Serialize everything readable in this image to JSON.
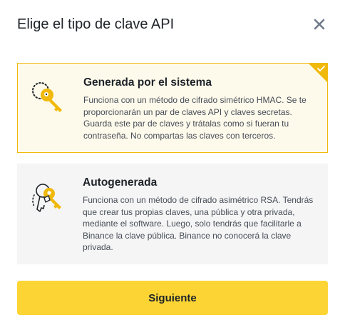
{
  "dialog": {
    "title": "Elige el tipo de clave API",
    "close_icon": "close-icon"
  },
  "options": [
    {
      "title": "Generada por el sistema",
      "description": "Funciona con un método de cifrado simétrico HMAC. Se te proporcionarán un par de claves API y claves secretas. Guarda este par de claves y trátalas como si fueran tu contraseña. No compartas las claves con terceros.",
      "icon": "system-key-icon",
      "selected": true
    },
    {
      "title": "Autogenerada",
      "description": "Funciona con un método de cifrado asimétrico RSA. Tendrás que crear tus propias claves, una pública y otra privada, mediante el software. Luego, solo tendrás que facilitarle a Binance la clave pública. Binance no conocerá la clave privada.",
      "icon": "self-generated-keys-icon",
      "selected": false
    }
  ],
  "actions": {
    "next_label": "Siguiente"
  },
  "colors": {
    "accent": "#f0b90b",
    "button": "#fcd535",
    "selected_bg": "#fefaeb",
    "card_bg": "#f5f5f5",
    "text": "#1e2329",
    "muted_text": "#474d57"
  }
}
